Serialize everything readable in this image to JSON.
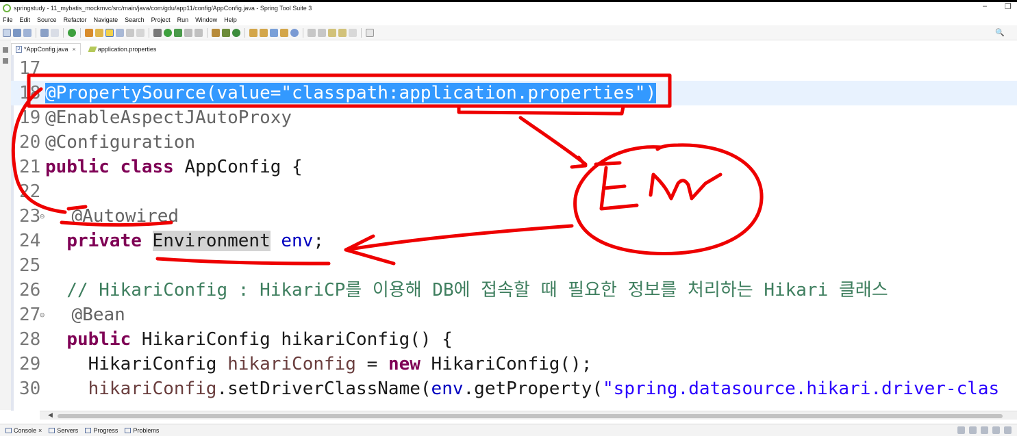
{
  "window": {
    "title": "springstudy - 11_mybatis_mockmvc/src/main/java/com/gdu/app11/config/AppConfig.java - Spring Tool Suite 3",
    "minimize": "–",
    "restore": "❐"
  },
  "menu": [
    "File",
    "Edit",
    "Source",
    "Refactor",
    "Navigate",
    "Search",
    "Project",
    "Run",
    "Window",
    "Help"
  ],
  "tabs": [
    {
      "label": "*AppConfig.java",
      "close": "×"
    },
    {
      "label": "application.properties"
    }
  ],
  "code": {
    "l17": {
      "n": "17"
    },
    "l18": {
      "n": "18",
      "t": "@PropertySource(value=\"classpath:application.properties\")"
    },
    "l19": {
      "n": "19",
      "t": "@EnableAspectJAutoProxy"
    },
    "l20": {
      "n": "20",
      "t": "@Configuration"
    },
    "l21": {
      "n": "21",
      "kw": "public class",
      "t": " AppConfig {"
    },
    "l22": {
      "n": "22"
    },
    "l23": {
      "n": "23",
      "t": "@Autowired"
    },
    "l24": {
      "n": "24",
      "kw": "private",
      "type": "Environment",
      "fld": "env",
      "end": ";"
    },
    "l25": {
      "n": "25"
    },
    "l26": {
      "n": "26",
      "t": "// HikariConfig : HikariCP를 이용해 DB에 접속할 때 필요한 정보를 처리하는 Hikari 클래스"
    },
    "l27": {
      "n": "27",
      "t": "@Bean"
    },
    "l28": {
      "n": "28",
      "kw": "public",
      "t": " HikariConfig hikariConfig() {"
    },
    "l29": {
      "n": "29",
      "a": "HikariConfig ",
      "var": "hikariConfig",
      "b": " = ",
      "kw": "new",
      "c": " HikariConfig();"
    },
    "l30": {
      "n": "30",
      "var": "hikariConfig",
      "a": ".setDriverClassName(",
      "fld": "env",
      "b": ".getProperty(",
      "str": "\"spring.datasource.hikari.driver-clas"
    }
  },
  "annotation": {
    "note": "Env"
  },
  "bottom_tabs": [
    {
      "label": "Console",
      "close": "×"
    },
    {
      "label": "Servers"
    },
    {
      "label": "Progress"
    },
    {
      "label": "Problems"
    }
  ]
}
